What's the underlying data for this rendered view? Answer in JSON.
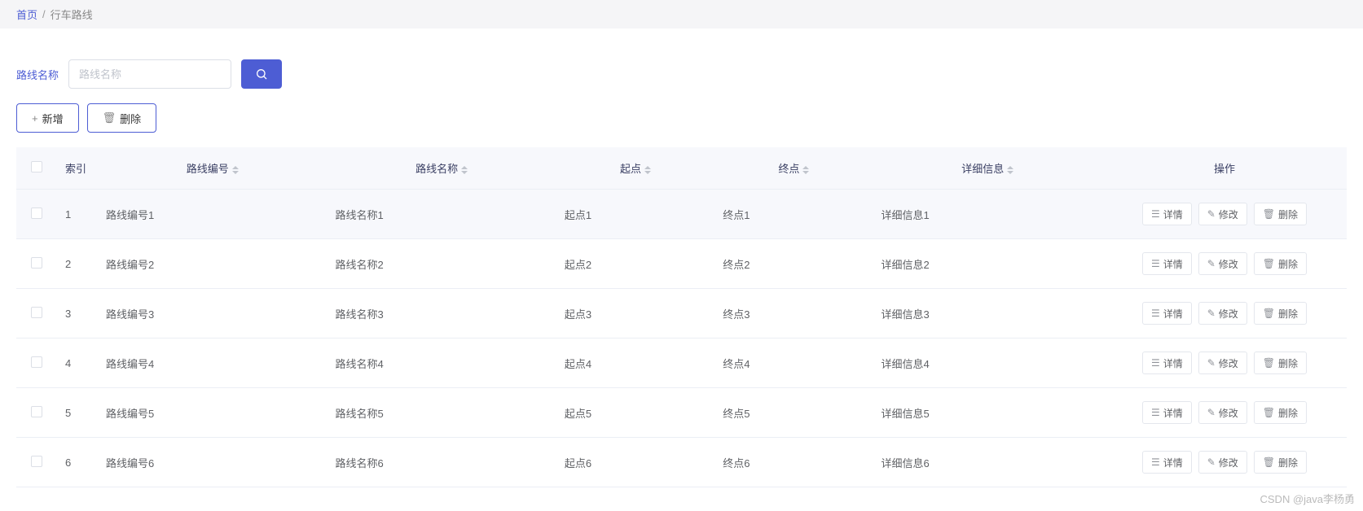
{
  "breadcrumb": {
    "home": "首页",
    "current": "行车路线"
  },
  "search": {
    "label": "路线名称",
    "placeholder": "路线名称"
  },
  "actions": {
    "add": "新增",
    "delete": "删除"
  },
  "table": {
    "headers": {
      "index": "索引",
      "code": "路线编号",
      "name": "路线名称",
      "start": "起点",
      "end": "终点",
      "detail": "详细信息",
      "ops": "操作"
    },
    "ops": {
      "detail": "详情",
      "edit": "修改",
      "delete": "删除"
    },
    "rows": [
      {
        "idx": "1",
        "code": "路线编号1",
        "name": "路线名称1",
        "start": "起点1",
        "end": "终点1",
        "detail": "详细信息1"
      },
      {
        "idx": "2",
        "code": "路线编号2",
        "name": "路线名称2",
        "start": "起点2",
        "end": "终点2",
        "detail": "详细信息2"
      },
      {
        "idx": "3",
        "code": "路线编号3",
        "name": "路线名称3",
        "start": "起点3",
        "end": "终点3",
        "detail": "详细信息3"
      },
      {
        "idx": "4",
        "code": "路线编号4",
        "name": "路线名称4",
        "start": "起点4",
        "end": "终点4",
        "detail": "详细信息4"
      },
      {
        "idx": "5",
        "code": "路线编号5",
        "name": "路线名称5",
        "start": "起点5",
        "end": "终点5",
        "detail": "详细信息5"
      },
      {
        "idx": "6",
        "code": "路线编号6",
        "name": "路线名称6",
        "start": "起点6",
        "end": "终点6",
        "detail": "详细信息6"
      }
    ]
  },
  "watermark": "CSDN @java李杨勇"
}
